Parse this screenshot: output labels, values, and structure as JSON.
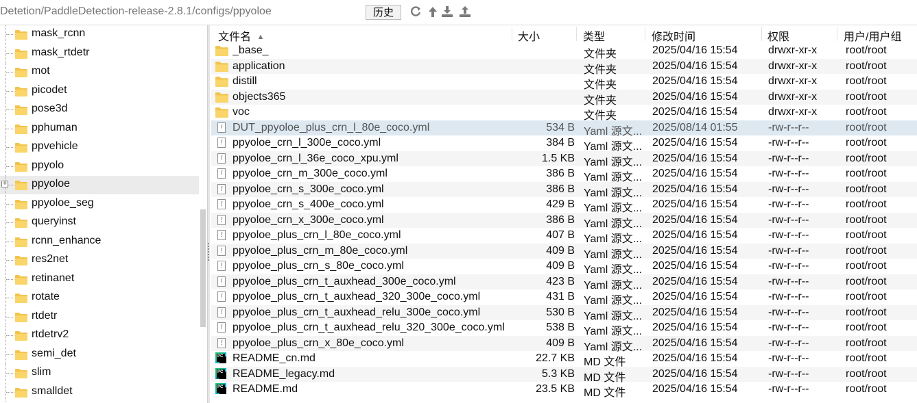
{
  "toolbar": {
    "path": "Detetion/PaddleDetection-release-2.8.1/configs/ppyoloe",
    "history_label": "历史",
    "icons": [
      "refresh-icon",
      "up-arrow-icon",
      "download-icon",
      "upload-icon"
    ]
  },
  "tree": {
    "items": [
      {
        "label": "mask_rcnn",
        "selected": false,
        "expander": false
      },
      {
        "label": "mask_rtdetr",
        "selected": false,
        "expander": false
      },
      {
        "label": "mot",
        "selected": false,
        "expander": false
      },
      {
        "label": "picodet",
        "selected": false,
        "expander": false
      },
      {
        "label": "pose3d",
        "selected": false,
        "expander": false
      },
      {
        "label": "pphuman",
        "selected": false,
        "expander": false
      },
      {
        "label": "ppvehicle",
        "selected": false,
        "expander": false
      },
      {
        "label": "ppyolo",
        "selected": false,
        "expander": false
      },
      {
        "label": "ppyoloe",
        "selected": true,
        "expander": true
      },
      {
        "label": "ppyoloe_seg",
        "selected": false,
        "expander": false
      },
      {
        "label": "queryinst",
        "selected": false,
        "expander": false
      },
      {
        "label": "rcnn_enhance",
        "selected": false,
        "expander": false
      },
      {
        "label": "res2net",
        "selected": false,
        "expander": false
      },
      {
        "label": "retinanet",
        "selected": false,
        "expander": false
      },
      {
        "label": "rotate",
        "selected": false,
        "expander": false
      },
      {
        "label": "rtdetr",
        "selected": false,
        "expander": false
      },
      {
        "label": "rtdetrv2",
        "selected": false,
        "expander": false
      },
      {
        "label": "semi_det",
        "selected": false,
        "expander": false
      },
      {
        "label": "slim",
        "selected": false,
        "expander": false
      },
      {
        "label": "smalldet",
        "selected": false,
        "expander": false
      }
    ]
  },
  "columns": {
    "name": "文件名",
    "size": "大小",
    "type": "类型",
    "modified": "修改时间",
    "perm": "权限",
    "owner": "用户/用户组",
    "sort_indicator": "▲"
  },
  "files": [
    {
      "name": "_base_",
      "size": "",
      "type": "文件夹",
      "modified": "2025/04/16 15:54",
      "perm": "drwxr-xr-x",
      "owner": "root/root",
      "icon": "folder-icon"
    },
    {
      "name": "application",
      "size": "",
      "type": "文件夹",
      "modified": "2025/04/16 15:54",
      "perm": "drwxr-xr-x",
      "owner": "root/root",
      "icon": "folder-icon"
    },
    {
      "name": "distill",
      "size": "",
      "type": "文件夹",
      "modified": "2025/04/16 15:54",
      "perm": "drwxr-xr-x",
      "owner": "root/root",
      "icon": "folder-icon"
    },
    {
      "name": "objects365",
      "size": "",
      "type": "文件夹",
      "modified": "2025/04/16 15:54",
      "perm": "drwxr-xr-x",
      "owner": "root/root",
      "icon": "folder-icon"
    },
    {
      "name": "voc",
      "size": "",
      "type": "文件夹",
      "modified": "2025/04/16 15:54",
      "perm": "drwxr-xr-x",
      "owner": "root/root",
      "icon": "folder-icon"
    },
    {
      "name": "DUT_ppyoloe_plus_crn_l_80e_coco.yml",
      "size": "534 B",
      "type": "Yaml 源文...",
      "modified": "2025/08/14 01:55",
      "perm": "-rw-r--r--",
      "owner": "root/root",
      "icon": "yaml-file-icon",
      "selected": true
    },
    {
      "name": "ppyoloe_crn_l_300e_coco.yml",
      "size": "384 B",
      "type": "Yaml 源文...",
      "modified": "2025/04/16 15:54",
      "perm": "-rw-r--r--",
      "owner": "root/root",
      "icon": "yaml-file-icon"
    },
    {
      "name": "ppyoloe_crn_l_36e_coco_xpu.yml",
      "size": "1.5 KB",
      "type": "Yaml 源文...",
      "modified": "2025/04/16 15:54",
      "perm": "-rw-r--r--",
      "owner": "root/root",
      "icon": "yaml-file-icon"
    },
    {
      "name": "ppyoloe_crn_m_300e_coco.yml",
      "size": "386 B",
      "type": "Yaml 源文...",
      "modified": "2025/04/16 15:54",
      "perm": "-rw-r--r--",
      "owner": "root/root",
      "icon": "yaml-file-icon"
    },
    {
      "name": "ppyoloe_crn_s_300e_coco.yml",
      "size": "386 B",
      "type": "Yaml 源文...",
      "modified": "2025/04/16 15:54",
      "perm": "-rw-r--r--",
      "owner": "root/root",
      "icon": "yaml-file-icon"
    },
    {
      "name": "ppyoloe_crn_s_400e_coco.yml",
      "size": "429 B",
      "type": "Yaml 源文...",
      "modified": "2025/04/16 15:54",
      "perm": "-rw-r--r--",
      "owner": "root/root",
      "icon": "yaml-file-icon"
    },
    {
      "name": "ppyoloe_crn_x_300e_coco.yml",
      "size": "386 B",
      "type": "Yaml 源文...",
      "modified": "2025/04/16 15:54",
      "perm": "-rw-r--r--",
      "owner": "root/root",
      "icon": "yaml-file-icon"
    },
    {
      "name": "ppyoloe_plus_crn_l_80e_coco.yml",
      "size": "407 B",
      "type": "Yaml 源文...",
      "modified": "2025/04/16 15:54",
      "perm": "-rw-r--r--",
      "owner": "root/root",
      "icon": "yaml-file-icon"
    },
    {
      "name": "ppyoloe_plus_crn_m_80e_coco.yml",
      "size": "409 B",
      "type": "Yaml 源文...",
      "modified": "2025/04/16 15:54",
      "perm": "-rw-r--r--",
      "owner": "root/root",
      "icon": "yaml-file-icon"
    },
    {
      "name": "ppyoloe_plus_crn_s_80e_coco.yml",
      "size": "409 B",
      "type": "Yaml 源文...",
      "modified": "2025/04/16 15:54",
      "perm": "-rw-r--r--",
      "owner": "root/root",
      "icon": "yaml-file-icon"
    },
    {
      "name": "ppyoloe_plus_crn_t_auxhead_300e_coco.yml",
      "size": "423 B",
      "type": "Yaml 源文...",
      "modified": "2025/04/16 15:54",
      "perm": "-rw-r--r--",
      "owner": "root/root",
      "icon": "yaml-file-icon"
    },
    {
      "name": "ppyoloe_plus_crn_t_auxhead_320_300e_coco.yml",
      "size": "431 B",
      "type": "Yaml 源文...",
      "modified": "2025/04/16 15:54",
      "perm": "-rw-r--r--",
      "owner": "root/root",
      "icon": "yaml-file-icon"
    },
    {
      "name": "ppyoloe_plus_crn_t_auxhead_relu_300e_coco.yml",
      "size": "530 B",
      "type": "Yaml 源文...",
      "modified": "2025/04/16 15:54",
      "perm": "-rw-r--r--",
      "owner": "root/root",
      "icon": "yaml-file-icon"
    },
    {
      "name": "ppyoloe_plus_crn_t_auxhead_relu_320_300e_coco.yml",
      "size": "538 B",
      "type": "Yaml 源文...",
      "modified": "2025/04/16 15:54",
      "perm": "-rw-r--r--",
      "owner": "root/root",
      "icon": "yaml-file-icon"
    },
    {
      "name": "ppyoloe_plus_crn_x_80e_coco.yml",
      "size": "409 B",
      "type": "Yaml 源文...",
      "modified": "2025/04/16 15:54",
      "perm": "-rw-r--r--",
      "owner": "root/root",
      "icon": "yaml-file-icon"
    },
    {
      "name": "README_cn.md",
      "size": "22.7 KB",
      "type": "MD 文件",
      "modified": "2025/04/16 15:54",
      "perm": "-rw-r--r--",
      "owner": "root/root",
      "icon": "pycharm-md-icon"
    },
    {
      "name": "README_legacy.md",
      "size": "5.3 KB",
      "type": "MD 文件",
      "modified": "2025/04/16 15:54",
      "perm": "-rw-r--r--",
      "owner": "root/root",
      "icon": "pycharm-md-icon"
    },
    {
      "name": "README.md",
      "size": "23.5 KB",
      "type": "MD 文件",
      "modified": "2025/04/16 15:54",
      "perm": "-rw-r--r--",
      "owner": "root/root",
      "icon": "pycharm-md-icon"
    }
  ],
  "colors": {
    "folder": "#f2c44d",
    "selection": "#dde8f1",
    "tree_selection": "#ebebeb",
    "stripe": "#f5f5f5"
  }
}
